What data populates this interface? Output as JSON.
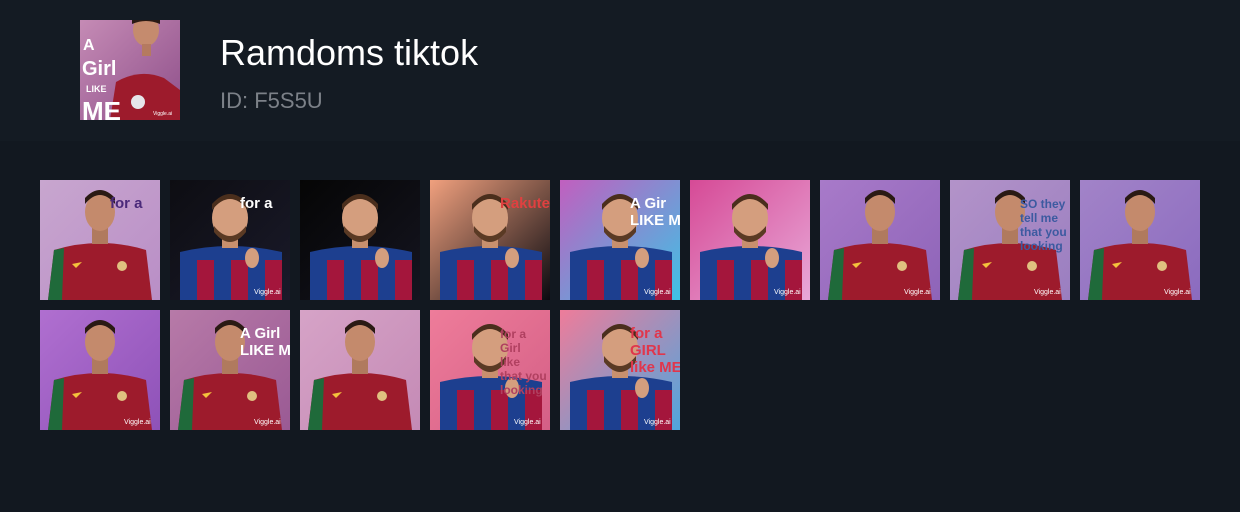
{
  "pack": {
    "title": "Ramdoms tiktok",
    "id_label": "ID: F5S5U",
    "cover": {
      "bg": "#b77aa8",
      "text_lines": [
        "A",
        "Girl",
        "LIKE",
        "ME"
      ],
      "watermark": "Viggle.ai",
      "player": "ronaldo"
    }
  },
  "stickers": [
    {
      "player": "ronaldo",
      "bg1": "#c8a6cf",
      "bg2": "#b98ec6",
      "text": "for a",
      "text_color": "#4b2a7a",
      "watermark": ""
    },
    {
      "player": "messi",
      "bg1": "#0d0d12",
      "bg2": "#1a1a2a",
      "text": "for a",
      "text_color": "#ffffff",
      "watermark": "Viggle.ai"
    },
    {
      "player": "messi",
      "bg1": "#050505",
      "bg2": "#151520",
      "text": "",
      "text_color": "#ffffff",
      "watermark": ""
    },
    {
      "player": "messi",
      "bg1": "#f0a07e",
      "bg2": "#0a0a10",
      "text": "Rakuten",
      "text_color": "#e04040",
      "watermark": ""
    },
    {
      "player": "messi",
      "bg1": "#c15fbf",
      "bg2": "#3ec2e6",
      "text": "A Gir LIKE ME",
      "text_color": "#ffffff",
      "watermark": "Viggle.ai"
    },
    {
      "player": "messi",
      "bg1": "#d64a96",
      "bg2": "#e8a8d8",
      "text": "",
      "text_color": "#ffffff",
      "watermark": "Viggle.ai"
    },
    {
      "player": "ronaldo",
      "bg1": "#a87ac9",
      "bg2": "#8e64b8",
      "text": "",
      "text_color": "#ffffff",
      "watermark": "Viggle.ai"
    },
    {
      "player": "ronaldo",
      "bg1": "#b393c9",
      "bg2": "#9a7ec0",
      "text": "SO they tell me that you looking",
      "text_color": "#3c5aa0",
      "watermark": "Viggle.ai"
    },
    {
      "player": "ronaldo",
      "bg1": "#a283c8",
      "bg2": "#8b6bbf",
      "text": "",
      "text_color": "#ffffff",
      "watermark": "Viggle.ai"
    },
    {
      "player": "ronaldo",
      "bg1": "#b06fd0",
      "bg2": "#8e52b8",
      "text": "",
      "text_color": "#ffffff",
      "watermark": "Viggle.ai"
    },
    {
      "player": "ronaldo",
      "bg1": "#b77aa8",
      "bg2": "#9a5a94",
      "text": "A Girl LIKE ME",
      "text_color": "#ffffff",
      "watermark": "Viggle.ai"
    },
    {
      "player": "ronaldo",
      "bg1": "#d6a3c7",
      "bg2": "#c48ab5",
      "text": "",
      "text_color": "#ffffff",
      "watermark": ""
    },
    {
      "player": "messi",
      "bg1": "#ee7c9a",
      "bg2": "#d45f86",
      "text": "for a Girl like that you looking",
      "text_color": "#b04060",
      "watermark": "Viggle.ai"
    },
    {
      "player": "messi",
      "bg1": "#ee7c9a",
      "bg2": "#4fa6de",
      "text": "for a GIRL like ME",
      "text_color": "#e0364c",
      "watermark": "Viggle.ai"
    }
  ]
}
